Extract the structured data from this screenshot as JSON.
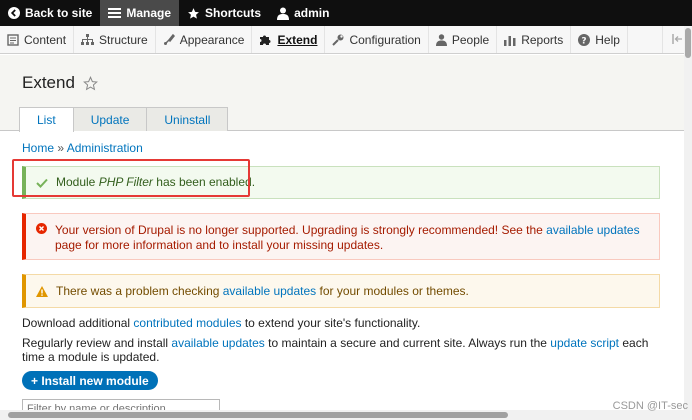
{
  "toolbar": {
    "back_label": "Back to site",
    "manage_label": "Manage",
    "shortcuts_label": "Shortcuts",
    "user_label": "admin"
  },
  "nav": {
    "items": [
      {
        "label": "Content",
        "icon": "content-icon"
      },
      {
        "label": "Structure",
        "icon": "structure-icon"
      },
      {
        "label": "Appearance",
        "icon": "appearance-icon"
      },
      {
        "label": "Extend",
        "icon": "puzzle-icon",
        "active": true
      },
      {
        "label": "Configuration",
        "icon": "wrench-icon"
      },
      {
        "label": "People",
        "icon": "person-icon"
      },
      {
        "label": "Reports",
        "icon": "bar-chart-icon"
      },
      {
        "label": "Help",
        "icon": "question-icon"
      }
    ]
  },
  "header": {
    "title": "Extend",
    "tabs": [
      {
        "label": "List",
        "active": true
      },
      {
        "label": "Update"
      },
      {
        "label": "Uninstall"
      }
    ]
  },
  "breadcrumb": {
    "home": "Home",
    "separator": "»",
    "current": "Administration"
  },
  "messages": {
    "status": {
      "prefix": "Module ",
      "module": "PHP Filter",
      "suffix": " has been enabled."
    },
    "error": {
      "text1": "Your version of Drupal is no longer supported. Upgrading is strongly recommended! See the ",
      "link": "available updates",
      "text2": " page for more information and to install your missing updates."
    },
    "warning": {
      "text1": "There was a problem checking ",
      "link": "available updates",
      "text2": " for your modules or themes."
    }
  },
  "content": {
    "download": {
      "text1": "Download additional ",
      "link": "contributed modules",
      "text2": " to extend your site's functionality."
    },
    "review": {
      "text1": "Regularly review and install ",
      "link1": "available updates",
      "text2": " to maintain a secure and current site. Always run the ",
      "link2": "update script",
      "text3": " each time a module is updated."
    },
    "install_button": "+ Install new module",
    "filter_placeholder": "Filter by name or description"
  },
  "watermark": "CSDN @IT-sec",
  "colors": {
    "toolbar_bg": "#0f0f0f",
    "link": "#0074bd",
    "status_border": "#77b259",
    "error_border": "#e62600",
    "warning_border": "#e09600",
    "highlight": "#e53935"
  }
}
